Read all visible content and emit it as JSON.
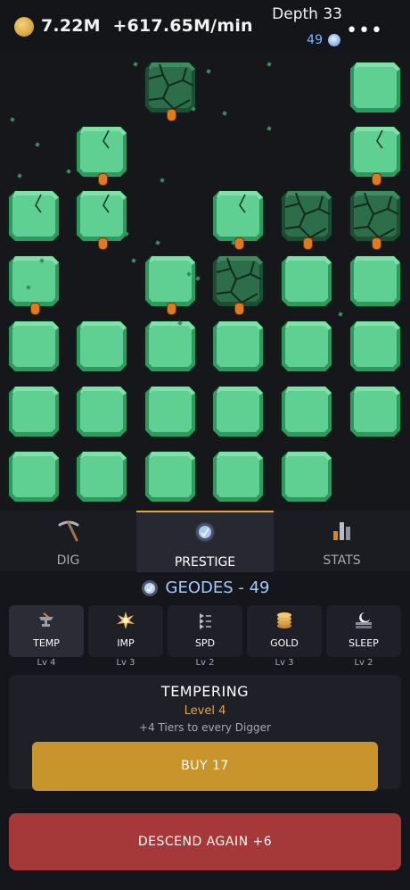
{
  "topbar": {
    "money": "7.22M",
    "rate": "+617.65M/min",
    "depth": "Depth 33",
    "geodes_count": "49",
    "menu_icon": "more-dots-icon"
  },
  "tabs": [
    {
      "label": "DIG",
      "icon": "pickaxe-icon",
      "active": false
    },
    {
      "label": "PRESTIGE",
      "icon": "geode-icon",
      "active": true
    },
    {
      "label": "STATS",
      "icon": "bar-chart-icon",
      "active": false
    }
  ],
  "geodes": {
    "label": "GEODES - 49"
  },
  "upgrades": [
    {
      "label": "TEMP",
      "level": "Lv 4",
      "icon": "anvil-icon",
      "selected": true
    },
    {
      "label": "IMP",
      "level": "Lv 3",
      "icon": "impact-burst-icon",
      "selected": false
    },
    {
      "label": "SPD",
      "level": "Lv 2",
      "icon": "speed-arrows-icon",
      "selected": false
    },
    {
      "label": "GOLD",
      "level": "Lv 3",
      "icon": "coin-stack-icon",
      "selected": false
    },
    {
      "label": "SLEEP",
      "level": "Lv 2",
      "icon": "moon-bed-icon",
      "selected": false
    }
  ],
  "detail": {
    "title": "TEMPERING",
    "level": "Level 4",
    "desc": "+4 Tiers to every Digger",
    "buy_label": "BUY  17"
  },
  "descend_label": "DESCEND AGAIN  +6",
  "colors": {
    "block_fill": "#5fcf92",
    "block_light": "#7fe0a9",
    "block_dark": "#2f9a5f",
    "cracked_fill": "#2c6e4a",
    "accent_orange": "#e8a33a",
    "descend_red": "#a53838",
    "buy_gold": "#c8952d"
  }
}
